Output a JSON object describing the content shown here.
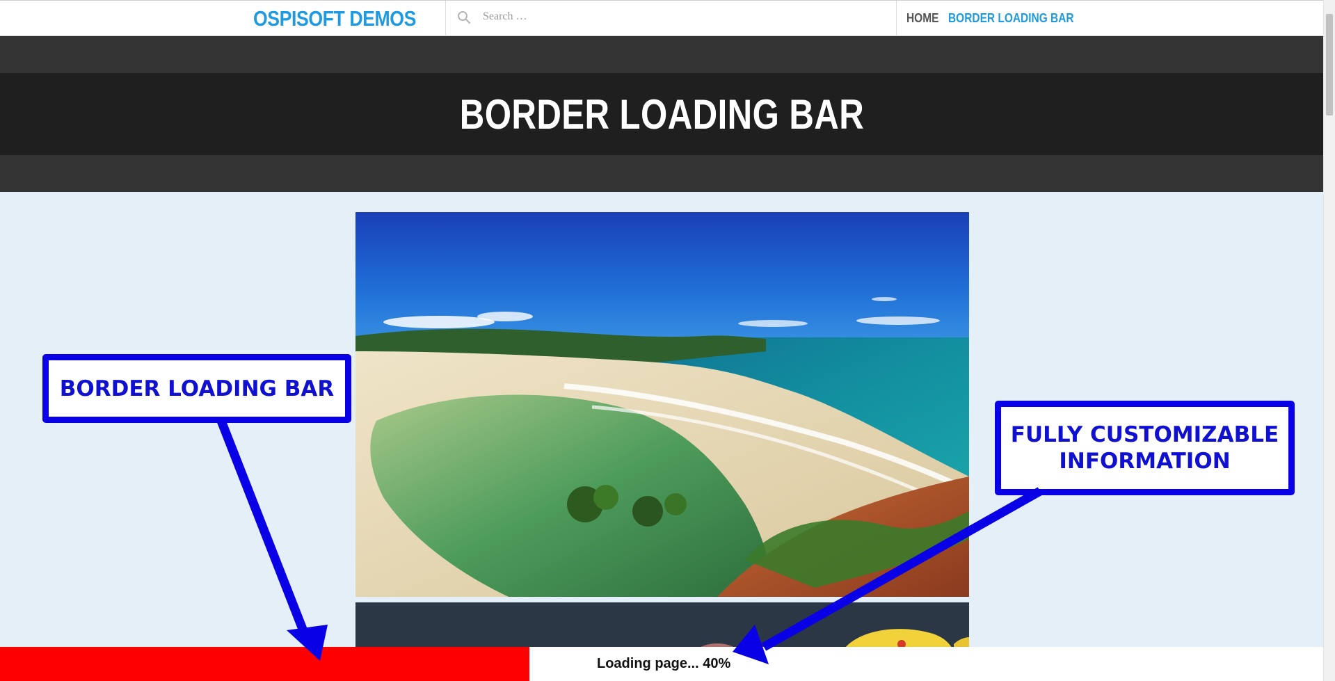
{
  "header": {
    "brand": "OSPISOFT DEMOS",
    "search_placeholder": "Search …",
    "nav": {
      "home": "HOME",
      "current": "BORDER LOADING BAR"
    }
  },
  "page": {
    "title": "BORDER LOADING BAR"
  },
  "callouts": {
    "left_label": "BORDER LOADING BAR",
    "right_line1": "FULLY CUSTOMIZABLE",
    "right_line2": "INFORMATION"
  },
  "loading": {
    "text": "Loading page... 40%",
    "progress": 0.4
  },
  "colors": {
    "accent": "#1e9be0",
    "callout_blue": "#0a00e6",
    "loading_fill": "#ff0000",
    "band_dark": "#1f1f1f",
    "band_mid": "#333333",
    "page_bg": "#e4eff8"
  },
  "icons": {
    "search": "search-icon"
  }
}
